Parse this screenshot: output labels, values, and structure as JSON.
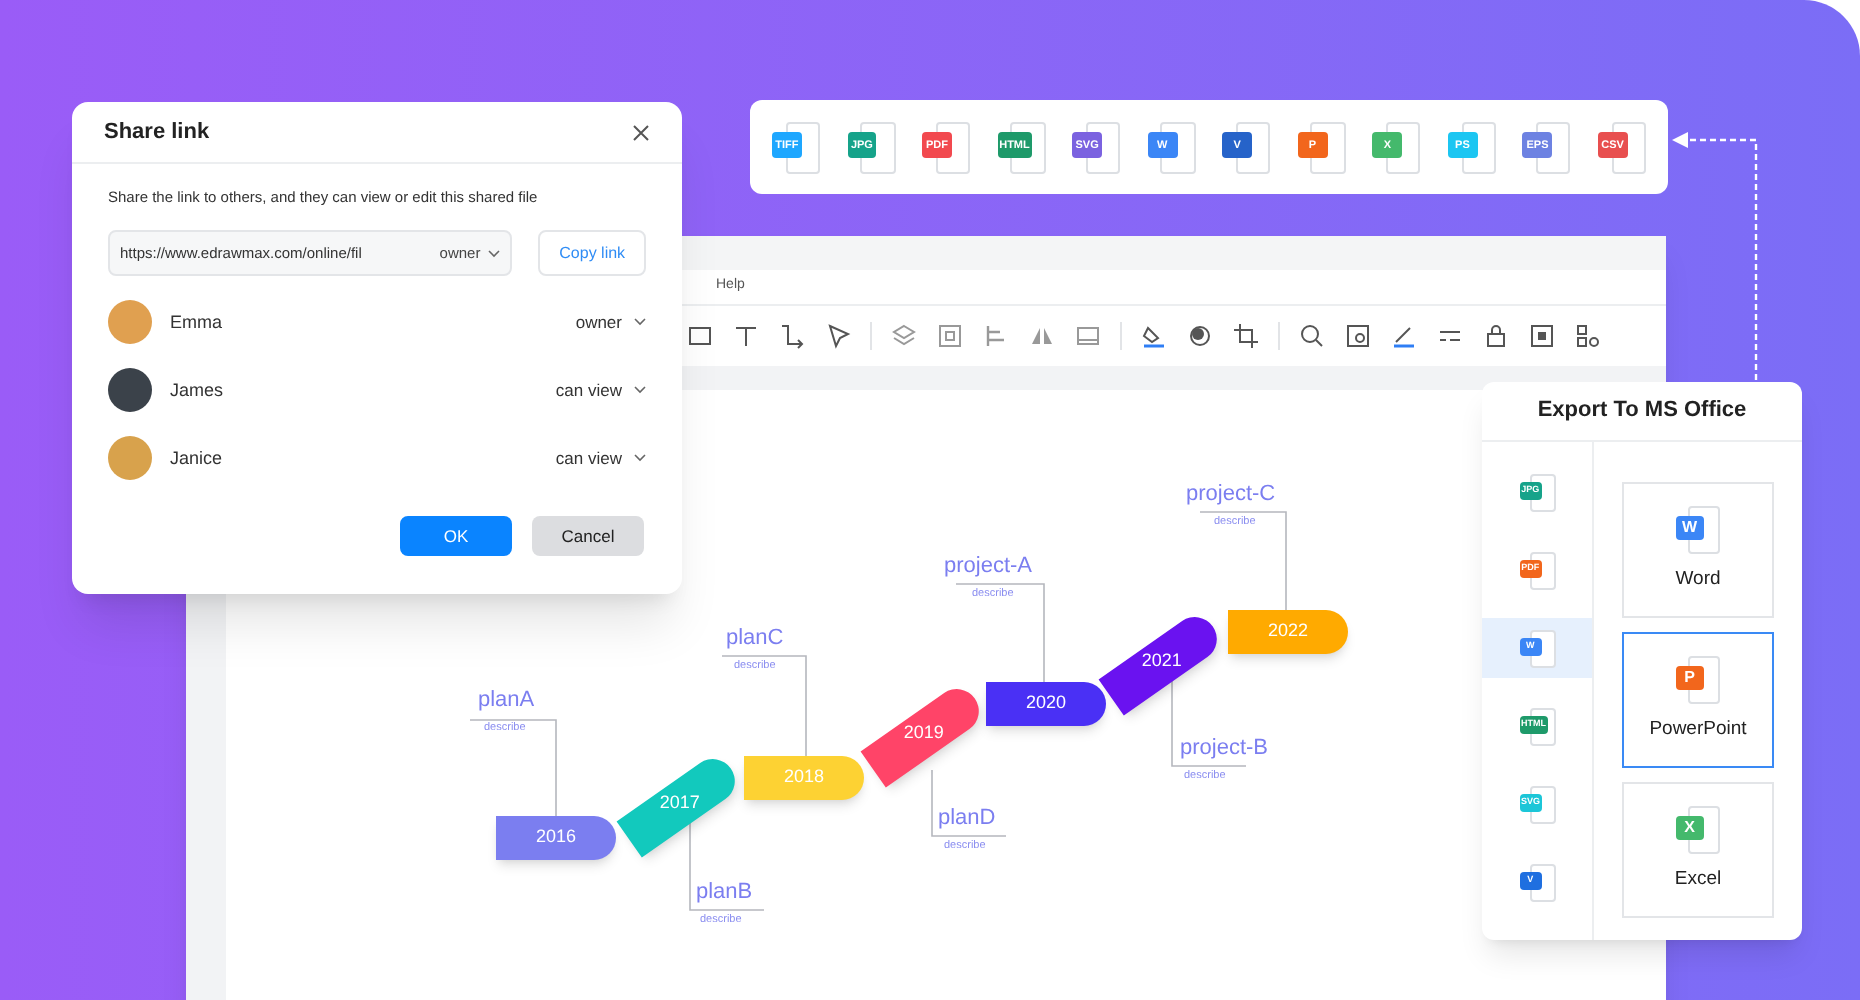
{
  "share_dialog": {
    "title": "Share link",
    "description": "Share the link to others, and they can view or edit this shared file",
    "link": {
      "value": "https://www.edrawmax.com/online/fil",
      "permission": "owner"
    },
    "copy_button": "Copy link",
    "users": [
      {
        "name": "Emma",
        "role": "owner",
        "color": "#e0a050"
      },
      {
        "name": "James",
        "role": "can view",
        "color": "#3b424a"
      },
      {
        "name": "Janice",
        "role": "can view",
        "color": "#d8a24c"
      }
    ],
    "ok_button": "OK",
    "cancel_button": "Cancel"
  },
  "format_bar": {
    "formats": [
      {
        "label": "TIFF",
        "color": "#1ea7ff"
      },
      {
        "label": "JPG",
        "color": "#16a38a"
      },
      {
        "label": "PDF",
        "color": "#f2494f"
      },
      {
        "label": "HTML",
        "color": "#1e9a6a"
      },
      {
        "label": "SVG",
        "color": "#7b62e0"
      },
      {
        "label": "W",
        "color": "#3b86f6"
      },
      {
        "label": "V",
        "color": "#2663c9"
      },
      {
        "label": "P",
        "color": "#f2661c"
      },
      {
        "label": "X",
        "color": "#44b96c"
      },
      {
        "label": "PS",
        "color": "#1cc6f2"
      },
      {
        "label": "EPS",
        "color": "#6d82e2"
      },
      {
        "label": "CSV",
        "color": "#e84f4f"
      }
    ]
  },
  "editor": {
    "menu": [
      "Help"
    ]
  },
  "timeline": {
    "segments": [
      {
        "year": "2016",
        "color": "#7b7ef0",
        "kind": "flat"
      },
      {
        "year": "2017",
        "color": "#12c9bd",
        "kind": "slant"
      },
      {
        "year": "2018",
        "color": "#fdd233",
        "kind": "flat"
      },
      {
        "year": "2019",
        "color": "#ff4468",
        "kind": "slant"
      },
      {
        "year": "2020",
        "color": "#4a30f5",
        "kind": "flat"
      },
      {
        "year": "2021",
        "color": "#6a12f0",
        "kind": "slant"
      },
      {
        "year": "2022",
        "color": "#ffaa00",
        "kind": "flat"
      }
    ],
    "annotations": [
      {
        "title": "project-C",
        "text": "describe"
      },
      {
        "title": "project-A",
        "text": "describe"
      },
      {
        "title": "planC",
        "text": "describe"
      },
      {
        "title": "planA",
        "text": "describe"
      },
      {
        "title": "project-B",
        "text": "describe"
      },
      {
        "title": "planD",
        "text": "describe"
      },
      {
        "title": "planB",
        "text": "describe"
      }
    ]
  },
  "export_panel": {
    "title": "Export To MS Office",
    "formats": [
      {
        "label": "JPG",
        "color": "#16a38a",
        "selected": false
      },
      {
        "label": "PDF",
        "color": "#f2661c",
        "selected": false
      },
      {
        "label": "W",
        "color": "#3b86f6",
        "selected": true
      },
      {
        "label": "HTML",
        "color": "#1e9a6a",
        "selected": false
      },
      {
        "label": "SVG",
        "color": "#1cc6d8",
        "selected": false
      },
      {
        "label": "V",
        "color": "#1f6fe0",
        "selected": false
      }
    ],
    "options": [
      {
        "label": "Word",
        "icon": "W",
        "color": "#3b86f6",
        "selected": false
      },
      {
        "label": "PowerPoint",
        "icon": "P",
        "color": "#f2661c",
        "selected": true
      },
      {
        "label": "Excel",
        "icon": "X",
        "color": "#44b96c",
        "selected": false
      }
    ]
  }
}
